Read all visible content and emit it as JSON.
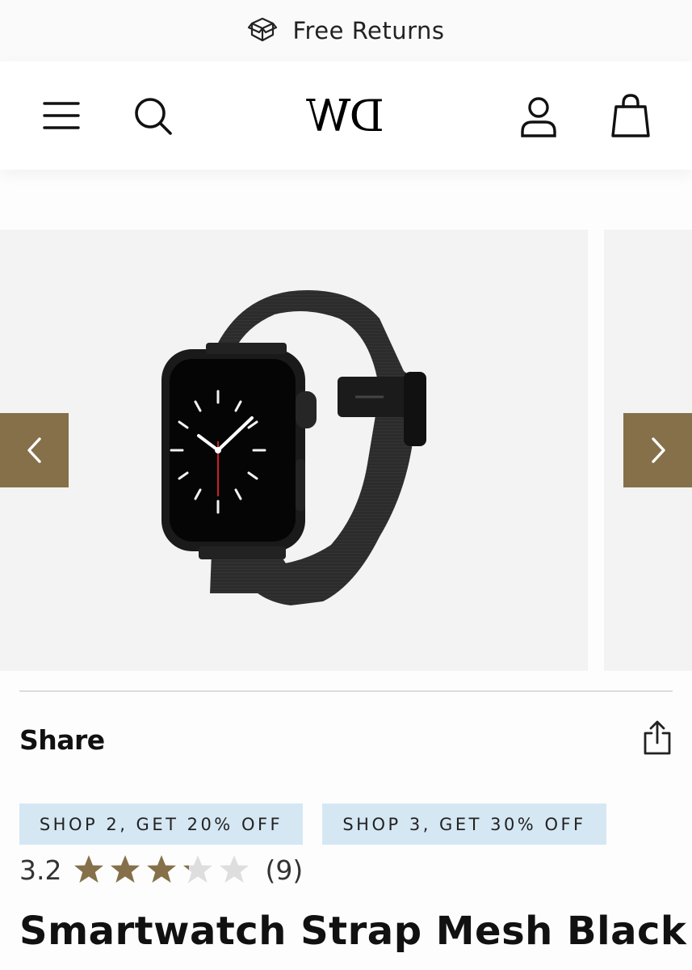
{
  "announcement": {
    "text": "Free Returns",
    "icon": "box-icon"
  },
  "header": {
    "logo_text": "DW",
    "icons": [
      "menu-icon",
      "search-icon",
      "account-icon",
      "bag-icon"
    ]
  },
  "gallery": {
    "image": "black-mesh-smartwatch-strap",
    "prev_icon": "chevron-left-icon",
    "next_icon": "chevron-right-icon"
  },
  "share": {
    "label": "Share",
    "icon": "share-icon"
  },
  "promos": [
    {
      "label": "SHOP 2, GET 20% OFF"
    },
    {
      "label": "SHOP 3, GET 30% OFF"
    }
  ],
  "rating": {
    "value": "3.2",
    "stars_filled": 3.2,
    "stars_total": 5,
    "count": "(9)"
  },
  "product": {
    "title": "Smartwatch Strap Mesh Black"
  },
  "colors": {
    "accent": "#85704a",
    "promo_bg": "#d5e7f3",
    "star_filled": "#85704a",
    "star_empty": "#dedede"
  }
}
